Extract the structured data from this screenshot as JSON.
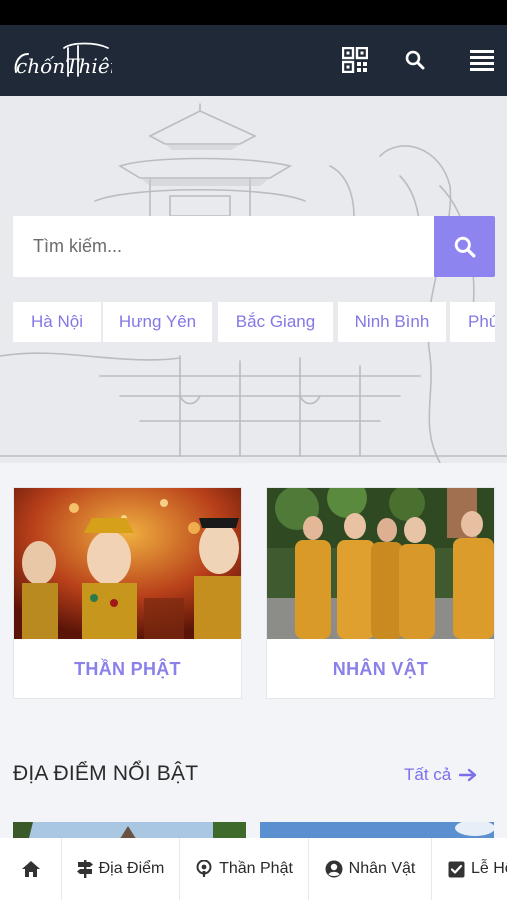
{
  "header": {
    "logo_text": "chốnThiêng",
    "qr_icon": "qr-code-icon",
    "search_icon": "search-icon",
    "menu_icon": "hamburger-menu-icon"
  },
  "search": {
    "placeholder": "Tìm kiếm...",
    "button_icon": "search-icon"
  },
  "location_chips": [
    "Hà Nội",
    "Hưng Yên",
    "Bắc Giang",
    "Ninh Bình",
    "Phú"
  ],
  "categories": [
    {
      "label": "THẦN PHẬT"
    },
    {
      "label": "NHÂN VẬT"
    }
  ],
  "featured": {
    "title": "ĐỊA ĐIỂM NỔI BẬT",
    "see_all": "Tất cả"
  },
  "bottom_nav": [
    {
      "label": "",
      "icon": "home-icon"
    },
    {
      "label": "Địa Điểm",
      "icon": "signpost-icon"
    },
    {
      "label": "Thần Phật",
      "icon": "podcast-icon"
    },
    {
      "label": "Nhân Vật",
      "icon": "user-circle-icon"
    },
    {
      "label": "Lễ Hội",
      "icon": "check-square-icon"
    }
  ],
  "colors": {
    "header_bg": "#1f2937",
    "accent": "#8e84f0",
    "accent_text": "#8a80ea"
  }
}
